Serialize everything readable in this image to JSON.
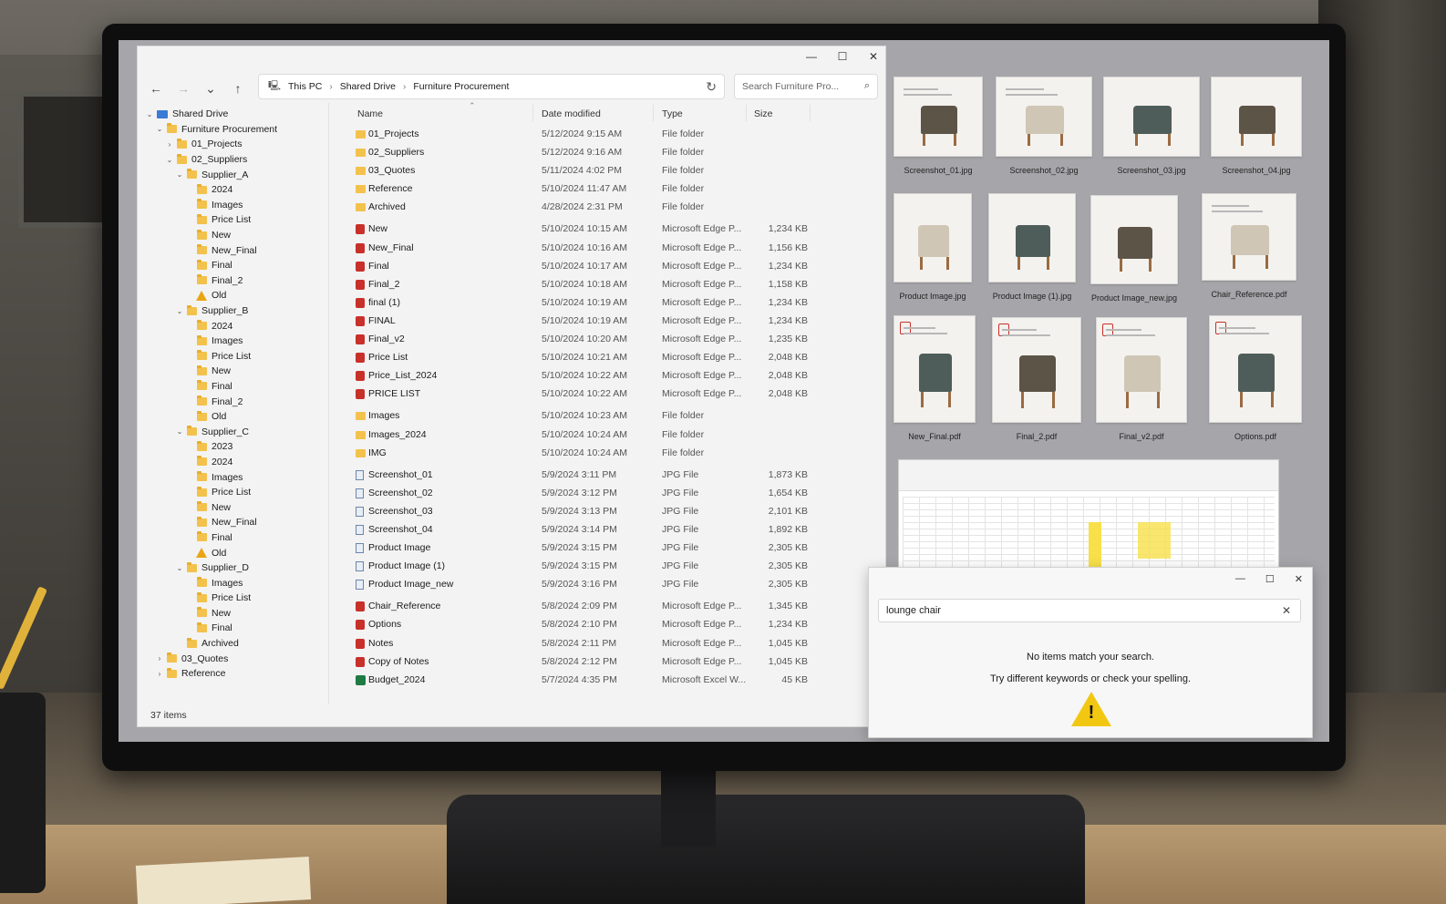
{
  "explorer": {
    "window_controls": [
      "—",
      "☐",
      "✕"
    ],
    "breadcrumb": [
      "This PC",
      "Shared Drive",
      "Furniture Procurement"
    ],
    "search_placeholder": "Search Furniture Pro...",
    "columns": {
      "name": "Name",
      "date": "Date modified",
      "type": "Type",
      "size": "Size"
    },
    "status": "37 items",
    "tree": [
      {
        "label": "Shared Drive",
        "depth": 0,
        "icon": "drive",
        "chev": "⌄"
      },
      {
        "label": "Furniture Procurement",
        "depth": 1,
        "icon": "folder",
        "chev": "⌄"
      },
      {
        "label": "01_Projects",
        "depth": 2,
        "icon": "folder",
        "chev": "›"
      },
      {
        "label": "02_Suppliers",
        "depth": 2,
        "icon": "folder",
        "chev": "⌄"
      },
      {
        "label": "Supplier_A",
        "depth": 3,
        "icon": "folder",
        "chev": "⌄"
      },
      {
        "label": "2024",
        "depth": 4,
        "icon": "folder",
        "chev": ""
      },
      {
        "label": "Images",
        "depth": 4,
        "icon": "folder",
        "chev": ""
      },
      {
        "label": "Price List",
        "depth": 4,
        "icon": "folder",
        "chev": ""
      },
      {
        "label": "New",
        "depth": 4,
        "icon": "folder",
        "chev": ""
      },
      {
        "label": "New_Final",
        "depth": 4,
        "icon": "folder",
        "chev": ""
      },
      {
        "label": "Final",
        "depth": 4,
        "icon": "folder",
        "chev": ""
      },
      {
        "label": "Final_2",
        "depth": 4,
        "icon": "folder",
        "chev": ""
      },
      {
        "label": "Old",
        "depth": 4,
        "icon": "warn",
        "chev": ""
      },
      {
        "label": "Supplier_B",
        "depth": 3,
        "icon": "folder",
        "chev": "⌄"
      },
      {
        "label": "2024",
        "depth": 4,
        "icon": "folder",
        "chev": ""
      },
      {
        "label": "Images",
        "depth": 4,
        "icon": "folder",
        "chev": ""
      },
      {
        "label": "Price List",
        "depth": 4,
        "icon": "folder",
        "chev": ""
      },
      {
        "label": "New",
        "depth": 4,
        "icon": "folder",
        "chev": ""
      },
      {
        "label": "Final",
        "depth": 4,
        "icon": "folder",
        "chev": ""
      },
      {
        "label": "Final_2",
        "depth": 4,
        "icon": "folder",
        "chev": ""
      },
      {
        "label": "Old",
        "depth": 4,
        "icon": "folder",
        "chev": ""
      },
      {
        "label": "Supplier_C",
        "depth": 3,
        "icon": "folder",
        "chev": "⌄"
      },
      {
        "label": "2023",
        "depth": 4,
        "icon": "folder",
        "chev": ""
      },
      {
        "label": "2024",
        "depth": 4,
        "icon": "folder",
        "chev": ""
      },
      {
        "label": "Images",
        "depth": 4,
        "icon": "folder",
        "chev": ""
      },
      {
        "label": "Price List",
        "depth": 4,
        "icon": "folder",
        "chev": ""
      },
      {
        "label": "New",
        "depth": 4,
        "icon": "folder",
        "chev": ""
      },
      {
        "label": "New_Final",
        "depth": 4,
        "icon": "folder",
        "chev": ""
      },
      {
        "label": "Final",
        "depth": 4,
        "icon": "folder",
        "chev": ""
      },
      {
        "label": "Old",
        "depth": 4,
        "icon": "warn",
        "chev": ""
      },
      {
        "label": "Supplier_D",
        "depth": 3,
        "icon": "folder",
        "chev": "⌄"
      },
      {
        "label": "Images",
        "depth": 4,
        "icon": "folder",
        "chev": ""
      },
      {
        "label": "Price List",
        "depth": 4,
        "icon": "folder",
        "chev": ""
      },
      {
        "label": "New",
        "depth": 4,
        "icon": "folder",
        "chev": ""
      },
      {
        "label": "Final",
        "depth": 4,
        "icon": "folder",
        "chev": ""
      },
      {
        "label": "Archived",
        "depth": 3,
        "icon": "folder",
        "chev": ""
      },
      {
        "label": "03_Quotes",
        "depth": 1,
        "icon": "folder",
        "chev": "›"
      },
      {
        "label": "Reference",
        "depth": 1,
        "icon": "folder",
        "chev": "›"
      }
    ],
    "files": [
      {
        "name": "01_Projects",
        "date": "5/12/2024 9:15 AM",
        "type": "File folder",
        "size": "",
        "icon": "folder"
      },
      {
        "name": "02_Suppliers",
        "date": "5/12/2024 9:16 AM",
        "type": "File folder",
        "size": "",
        "icon": "folder"
      },
      {
        "name": "03_Quotes",
        "date": "5/11/2024 4:02 PM",
        "type": "File folder",
        "size": "",
        "icon": "folder"
      },
      {
        "name": "Reference",
        "date": "5/10/2024 11:47 AM",
        "type": "File folder",
        "size": "",
        "icon": "folder"
      },
      {
        "name": "Archived",
        "date": "4/28/2024 2:31 PM",
        "type": "File folder",
        "size": "",
        "icon": "folder"
      },
      {
        "name": "New",
        "date": "5/10/2024 10:15 AM",
        "type": "Microsoft Edge P...",
        "size": "1,234 KB",
        "icon": "pdf"
      },
      {
        "name": "New_Final",
        "date": "5/10/2024 10:16 AM",
        "type": "Microsoft Edge P...",
        "size": "1,156 KB",
        "icon": "pdf"
      },
      {
        "name": "Final",
        "date": "5/10/2024 10:17 AM",
        "type": "Microsoft Edge P...",
        "size": "1,234 KB",
        "icon": "pdf"
      },
      {
        "name": "Final_2",
        "date": "5/10/2024 10:18 AM",
        "type": "Microsoft Edge P...",
        "size": "1,158 KB",
        "icon": "pdf"
      },
      {
        "name": "final (1)",
        "date": "5/10/2024 10:19 AM",
        "type": "Microsoft Edge P...",
        "size": "1,234 KB",
        "icon": "pdf"
      },
      {
        "name": "FINAL",
        "date": "5/10/2024 10:19 AM",
        "type": "Microsoft Edge P...",
        "size": "1,234 KB",
        "icon": "pdf"
      },
      {
        "name": "Final_v2",
        "date": "5/10/2024 10:20 AM",
        "type": "Microsoft Edge P...",
        "size": "1,235 KB",
        "icon": "pdf"
      },
      {
        "name": "Price List",
        "date": "5/10/2024 10:21 AM",
        "type": "Microsoft Edge P...",
        "size": "2,048 KB",
        "icon": "pdf"
      },
      {
        "name": "Price_List_2024",
        "date": "5/10/2024 10:22 AM",
        "type": "Microsoft Edge P...",
        "size": "2,048 KB",
        "icon": "pdf"
      },
      {
        "name": "PRICE LIST",
        "date": "5/10/2024 10:22 AM",
        "type": "Microsoft Edge P...",
        "size": "2,048 KB",
        "icon": "pdf"
      },
      {
        "name": "Images",
        "date": "5/10/2024 10:23 AM",
        "type": "File folder",
        "size": "",
        "icon": "folder"
      },
      {
        "name": "Images_2024",
        "date": "5/10/2024 10:24 AM",
        "type": "File folder",
        "size": "",
        "icon": "folder"
      },
      {
        "name": "IMG",
        "date": "5/10/2024 10:24 AM",
        "type": "File folder",
        "size": "",
        "icon": "folder"
      },
      {
        "name": "Screenshot_01",
        "date": "5/9/2024 3:11 PM",
        "type": "JPG File",
        "size": "1,873 KB",
        "icon": "jpg"
      },
      {
        "name": "Screenshot_02",
        "date": "5/9/2024 3:12 PM",
        "type": "JPG File",
        "size": "1,654 KB",
        "icon": "jpg"
      },
      {
        "name": "Screenshot_03",
        "date": "5/9/2024 3:13 PM",
        "type": "JPG File",
        "size": "2,101 KB",
        "icon": "jpg"
      },
      {
        "name": "Screenshot_04",
        "date": "5/9/2024 3:14 PM",
        "type": "JPG File",
        "size": "1,892 KB",
        "icon": "jpg"
      },
      {
        "name": "Product Image",
        "date": "5/9/2024 3:15 PM",
        "type": "JPG File",
        "size": "2,305 KB",
        "icon": "jpg"
      },
      {
        "name": "Product Image (1)",
        "date": "5/9/2024 3:15 PM",
        "type": "JPG File",
        "size": "2,305 KB",
        "icon": "jpg"
      },
      {
        "name": "Product Image_new",
        "date": "5/9/2024 3:16 PM",
        "type": "JPG File",
        "size": "2,305 KB",
        "icon": "jpg"
      },
      {
        "name": "Chair_Reference",
        "date": "5/8/2024 2:09 PM",
        "type": "Microsoft Edge P...",
        "size": "1,345 KB",
        "icon": "pdf"
      },
      {
        "name": "Options",
        "date": "5/8/2024 2:10 PM",
        "type": "Microsoft Edge P...",
        "size": "1,234 KB",
        "icon": "pdf"
      },
      {
        "name": "Notes",
        "date": "5/8/2024 2:11 PM",
        "type": "Microsoft Edge P...",
        "size": "1,045 KB",
        "icon": "pdf"
      },
      {
        "name": "Copy of Notes",
        "date": "5/8/2024 2:12 PM",
        "type": "Microsoft Edge P...",
        "size": "1,045 KB",
        "icon": "pdf"
      },
      {
        "name": "Budget_2024",
        "date": "5/7/2024 4:35 PM",
        "type": "Microsoft Excel W...",
        "size": "45 KB",
        "icon": "xls"
      }
    ]
  },
  "thumbnails": [
    {
      "label": "Screenshot_01.jpg",
      "kind": "doc"
    },
    {
      "label": "Screenshot_02.jpg",
      "kind": "doc"
    },
    {
      "label": "Screenshot_03.jpg",
      "kind": "photo"
    },
    {
      "label": "Screenshot_04.jpg",
      "kind": "photo"
    },
    {
      "label": "Product Image.jpg",
      "kind": "photo"
    },
    {
      "label": "Product Image (1).jpg",
      "kind": "photo"
    },
    {
      "label": "Product Image_new.jpg",
      "kind": "photo"
    },
    {
      "label": "Chair_Reference.pdf",
      "kind": "doc"
    },
    {
      "label": "New_Final.pdf",
      "kind": "pdf"
    },
    {
      "label": "Final_2.pdf",
      "kind": "pdf"
    },
    {
      "label": "Final_v2.pdf",
      "kind": "pdf"
    },
    {
      "label": "Options.pdf",
      "kind": "pdf"
    }
  ],
  "search_dialog": {
    "window_controls": [
      "—",
      "☐",
      "✕"
    ],
    "query": "lounge chair",
    "clear": "✕",
    "message": "No items match your search.",
    "hint": "Try different keywords or check your spelling.",
    "warning_mark": "!"
  },
  "icons": {
    "back": "←",
    "forward": "→",
    "recent": "⌄",
    "up": "↑",
    "pc": "🖳",
    "sep": "›",
    "refresh": "↻",
    "search": "⌕",
    "sort": "⌃"
  }
}
